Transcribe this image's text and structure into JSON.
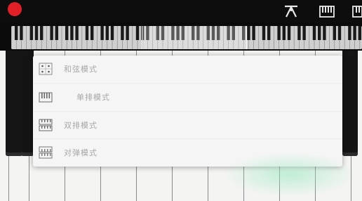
{
  "toolbar": {
    "record": {
      "icon": "record-icon",
      "color": "#e01f26"
    },
    "icons": [
      "chord-strum-icon",
      "keyboard-mode-icon",
      "more-icon"
    ]
  },
  "menu": {
    "items": [
      {
        "label": "和弦模式",
        "icon": "chord-mode-icon"
      },
      {
        "label": "单排模式",
        "icon": "single-row-icon"
      },
      {
        "label": "双排模式",
        "icon": "double-row-icon"
      },
      {
        "label": "对弹模式",
        "icon": "duet-mode-icon"
      }
    ]
  },
  "colors": {
    "accent": "#e01f26",
    "menu_background": "#f6f5f5",
    "menu_text": "#a7a7a7",
    "white_key": "#f4f4f2",
    "black_key": "#141414"
  }
}
